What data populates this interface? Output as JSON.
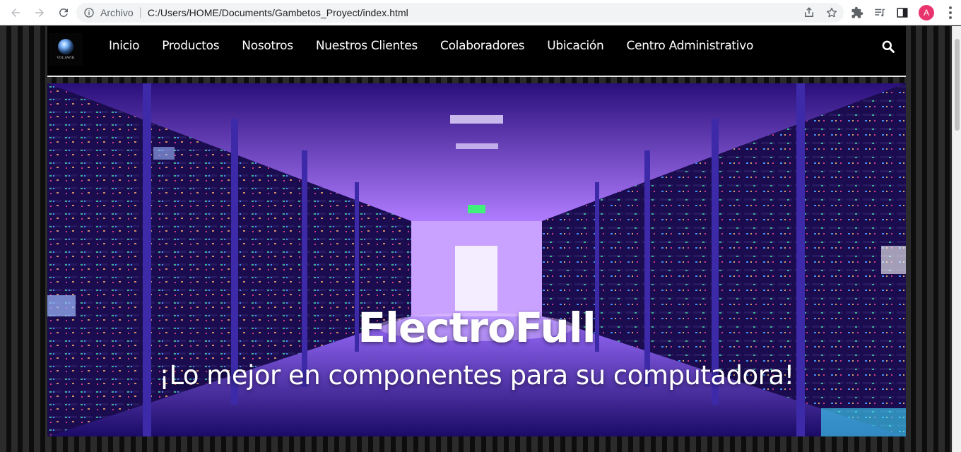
{
  "browser": {
    "protocol_label": "Archivo",
    "url": "C:/Users/HOME/Documents/Gambetos_Proyect/index.html",
    "profile_initial": "A",
    "profile_color": "#e8336d"
  },
  "site": {
    "logo_text": "VOLAWIK",
    "nav": [
      "Inicio",
      "Productos",
      "Nosotros",
      "Nuestros Clientes",
      "Colaboradores",
      "Ubicación",
      "Centro Administrativo"
    ]
  },
  "hero": {
    "title": "ElectroFull",
    "subtitle": "¡Lo mejor en componentes para su computadora!"
  }
}
